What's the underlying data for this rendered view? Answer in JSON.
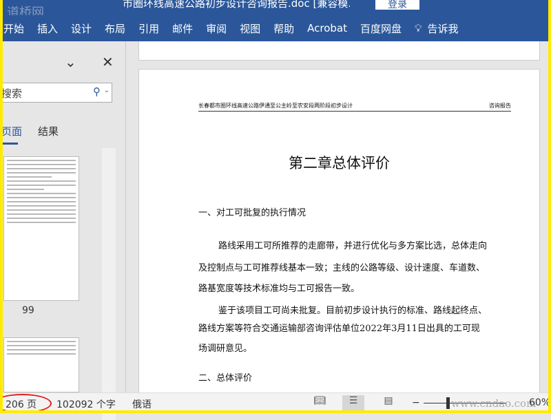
{
  "titlebar": {
    "title": "市圈环线高速公路初步设计咨询报告.doc [兼容模...",
    "login": "登录",
    "watermark": "道桥网"
  },
  "ribbon": {
    "tabs": [
      "开始",
      "插入",
      "设计",
      "布局",
      "引用",
      "邮件",
      "审阅",
      "视图",
      "帮助",
      "Acrobat",
      "百度网盘"
    ],
    "tell_me": "告诉我"
  },
  "nav": {
    "search_placeholder": "搜索",
    "tab_pages": "页面",
    "tab_results": "结果",
    "page_number": "99"
  },
  "doc": {
    "header_left": "长春都市圈环线高速公路伊通至公主岭至农安段两阶段初步设计",
    "header_right": "咨询报告",
    "chapter": "第二章总体评价",
    "section1": "一、对工可批复的执行情况",
    "para1": [
      "路线采用工可所推荐的走廊带，并进行优化与多方案比选，总体走向",
      "及控制点与工可推荐线基本一致；主线的公路等级、设计速度、车道数、",
      "路基宽度等技术标准均与工可报告一致。"
    ],
    "para2": [
      "鉴于该项目工可尚未批复。目前初步设计执行的标准、路线起终点、",
      "路线方案等符合交通运输部咨询评估单位2022年3月11日出具的工可现",
      "场调研意见。"
    ],
    "section2": "二、总体评价"
  },
  "status": {
    "pages": "206 页",
    "words": "102092 个字",
    "language": "俄语",
    "zoom": "60%",
    "watermark": "www.cndao.com"
  }
}
